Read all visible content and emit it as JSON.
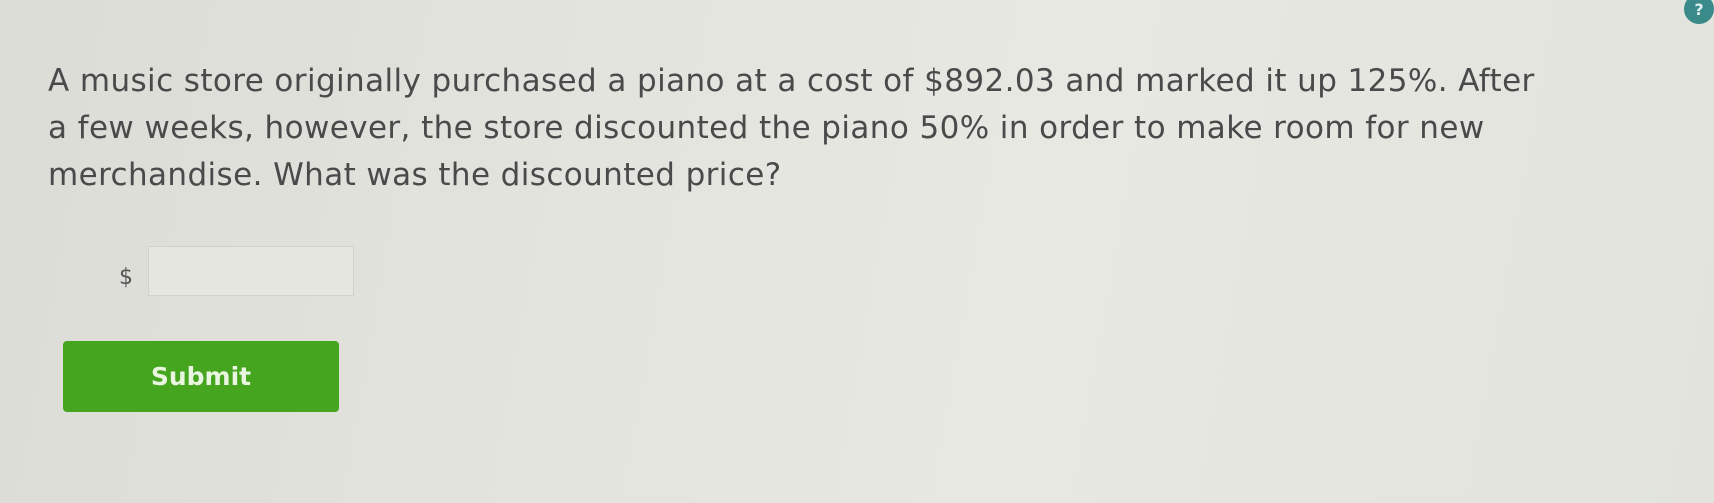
{
  "question": {
    "lines": [
      "A music store originally purchased a piano at a cost of $892.03 and marked it up 125%. After",
      "a few weeks, however, the store discounted the piano 50% in order to make room for new",
      "merchandise. What was the discounted price?"
    ]
  },
  "answer": {
    "currency_symbol": "$",
    "value": ""
  },
  "submit": {
    "label": "Submit",
    "color": "#46a51f"
  },
  "help": {
    "icon": "help-icon",
    "label": "?"
  }
}
